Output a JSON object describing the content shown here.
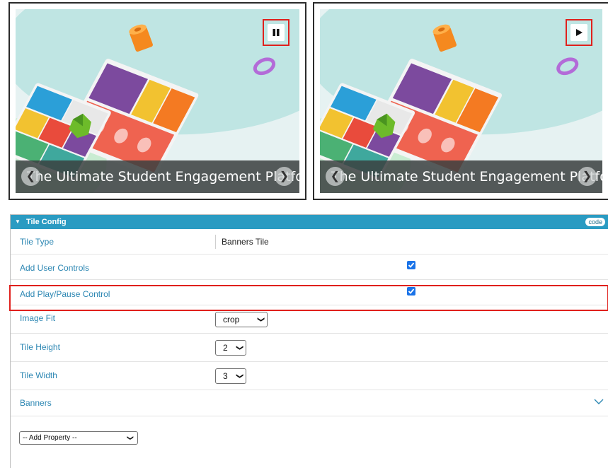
{
  "banners": [
    {
      "caption": "The Ultimate Student Engagement Platform",
      "control": "pause",
      "control_icon": "pause-icon"
    },
    {
      "caption": "The Ultimate Student Engagement Platform",
      "control": "play",
      "control_icon": "play-icon"
    }
  ],
  "nav_icons": {
    "prev": "chevron-left-icon",
    "next": "chevron-right-icon"
  },
  "config": {
    "header_title": "Tile Config",
    "code_badge": "code",
    "rows": {
      "tile_type": {
        "label": "Tile Type",
        "value": "Banners Tile"
      },
      "add_user_controls": {
        "label": "Add User Controls",
        "checked": true
      },
      "add_play_pause": {
        "label": "Add Play/Pause Control",
        "checked": true
      },
      "image_fit": {
        "label": "Image Fit",
        "value": "crop"
      },
      "tile_height": {
        "label": "Tile Height",
        "value": "2"
      },
      "tile_width": {
        "label": "Tile Width",
        "value": "3"
      },
      "banners": {
        "label": "Banners"
      }
    },
    "add_property": "-- Add Property --"
  },
  "colors": {
    "header": "#2a9bc2",
    "label": "#2d87b3",
    "highlight": "#e0201c",
    "checkbox": "#1a73e8"
  }
}
